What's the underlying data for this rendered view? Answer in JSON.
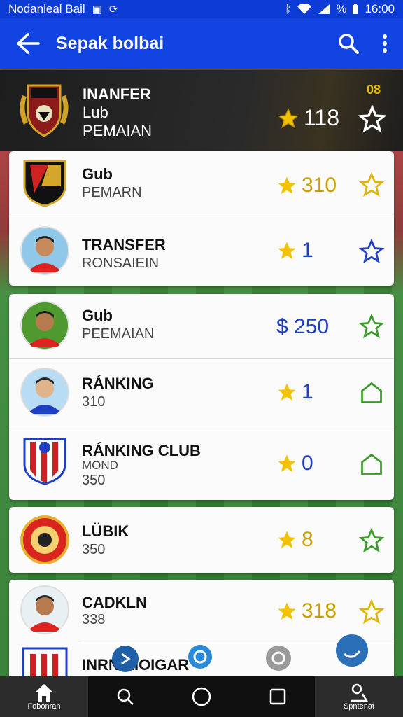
{
  "status_bar": {
    "left_text": "Nodanleal Bail",
    "battery": "%",
    "time": "16:00"
  },
  "app_bar": {
    "title": "Sepak bolbai"
  },
  "header_card": {
    "line1": "INANFER",
    "line2": "Lub",
    "line3": "PEMAIAN",
    "score": "118",
    "mini_badge": "08"
  },
  "list": [
    {
      "name": "Gub",
      "sub": "PEMARN",
      "value": "310",
      "value_color": "#c9a000",
      "icon": "star"
    },
    {
      "name": "TRANSFER",
      "sub": "RONSAIEIN",
      "value": "1",
      "value_color": "#1d3fc4",
      "icon": "star"
    },
    {
      "name": "Gub",
      "sub": "PEEMAIAN",
      "value": "$ 250",
      "value_color": "#1d3fc4",
      "icon": "dollar"
    },
    {
      "name": "RÁNKING",
      "sub": "310",
      "value": "1",
      "value_color": "#1d3fc4",
      "icon": "star"
    },
    {
      "name": "RÁNKING CLUB",
      "sub": "MOND",
      "sub2": "350",
      "value": "0",
      "value_color": "#1d3fc4",
      "icon": "star"
    },
    {
      "name": "LÜBIK",
      "sub": "350",
      "value": "8",
      "value_color": "#c9a000",
      "icon": "star"
    },
    {
      "name": "CADKLN",
      "sub": "338",
      "value": "318",
      "value_color": "#c9a000",
      "icon": "star"
    },
    {
      "name": "INRN AIOIGAR",
      "sub": "",
      "value": "",
      "value_color": "#1d3fc4",
      "icon": "star"
    }
  ],
  "bottom_nav": {
    "home_label": "Fobonran",
    "settings_label": "Spntenat"
  },
  "colors": {
    "primary": "#1144e0",
    "status": "#0d3bd6",
    "gold": "#f2c200",
    "green_icon": "#3a9a2a",
    "blue_icon": "#1d3fc4"
  }
}
